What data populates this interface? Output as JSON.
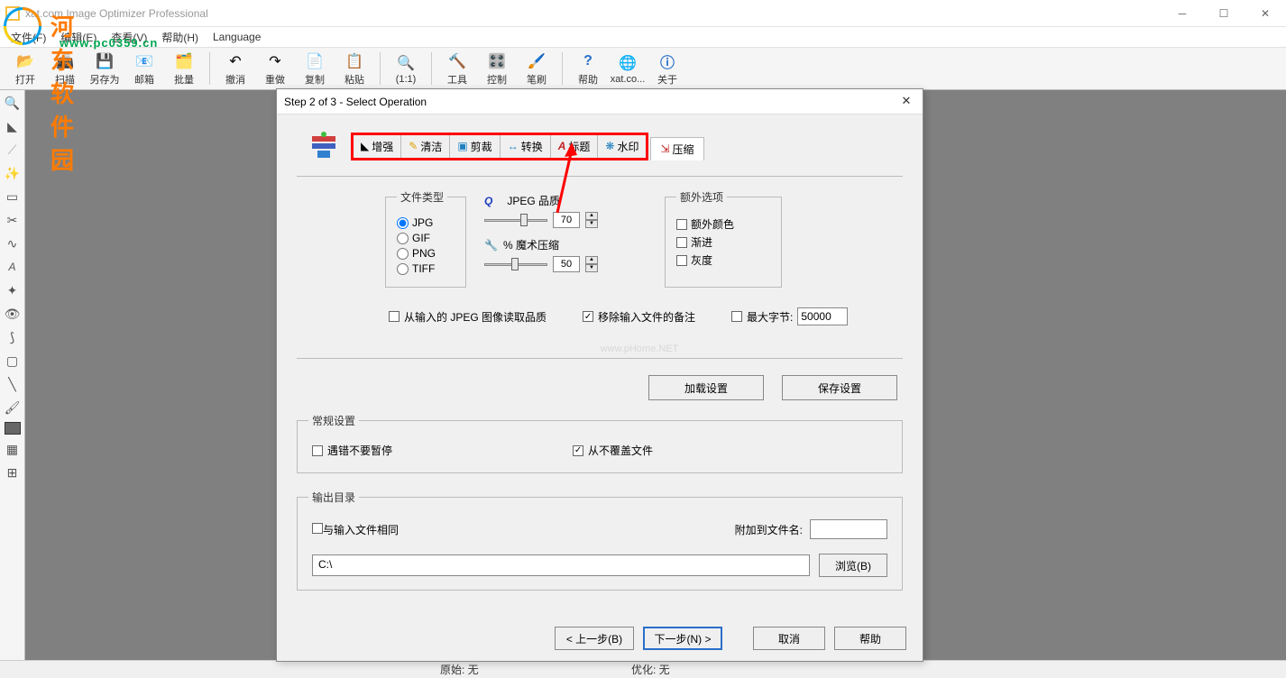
{
  "app": {
    "title": "xat.com   Image Optimizer Professional"
  },
  "watermark": {
    "brand": "河东软件园",
    "url": "www.pc0359.cn"
  },
  "menu": {
    "file": "文件(F)",
    "edit": "编辑(E)",
    "view": "查看(V)",
    "help": "帮助(H)",
    "language": "Language"
  },
  "toolbar": {
    "open": "打开",
    "scan": "扫描",
    "saveas": "另存为",
    "mail": "邮箱",
    "batch": "批量",
    "undo": "撤消",
    "redo": "重做",
    "copy": "复制",
    "paste": "粘贴",
    "oneone": "(1:1)",
    "tools": "工具",
    "control": "控制",
    "brush": "笔刷",
    "help": "帮助",
    "xat": "xat.co...",
    "about": "关于"
  },
  "dialog": {
    "title": "Step 2 of 3 - Select Operation",
    "tabs": {
      "enhance": "增强",
      "clean": "清洁",
      "crop": "剪裁",
      "convert": "转换",
      "title": "标题",
      "watermark": "水印",
      "compress": "压缩"
    },
    "filetype": {
      "legend": "文件类型",
      "jpg": "JPG",
      "gif": "GIF",
      "png": "PNG",
      "tiff": "TIFF"
    },
    "quality": {
      "jpeg_label": "JPEG 品质",
      "jpeg_value": "70",
      "magic_label": "% 魔术压缩",
      "magic_value": "50",
      "q_symbol": "Q"
    },
    "extra": {
      "legend": "额外选项",
      "extra_color": "额外颜色",
      "progressive": "渐进",
      "gray": "灰度"
    },
    "options": {
      "read_quality": "从输入的 JPEG 图像读取品质",
      "remove_comment": "移除输入文件的备注",
      "max_bytes": "最大字节:",
      "max_bytes_value": "50000"
    },
    "phome": "www.pHome.NET",
    "buttons": {
      "load": "加载设置",
      "save": "保存设置"
    },
    "general": {
      "legend": "常规设置",
      "no_pause": "遇错不要暂停",
      "no_overwrite": "从不覆盖文件"
    },
    "output": {
      "legend": "输出目录",
      "same_as_input": "与输入文件相同",
      "append_label": "附加到文件名:",
      "append_value": "",
      "path": "C:\\",
      "browse": "浏览(B)"
    },
    "footer": {
      "back": "< 上一步(B)",
      "next": "下一步(N) >",
      "cancel": "取消",
      "help": "帮助"
    }
  },
  "status": {
    "original": "原始: 无",
    "optimized": "优化: 无"
  }
}
